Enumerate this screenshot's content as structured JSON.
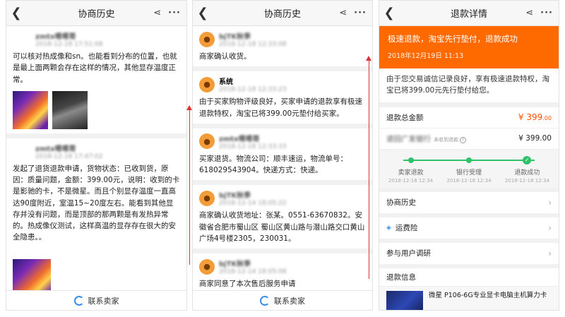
{
  "panel1": {
    "title": "协商历史",
    "posts": [
      {
        "name": "zmtx嗯嗯哥",
        "time": "2018-12-18 17:51:08",
        "text": "可以核对热成像和sn。也能看到分布的位置，也就是最上面两颗会存在这样的情况，其他显存温度正常。"
      },
      {
        "name": "zmtx嗯嗯哥",
        "time": "2018-12-18 17:47:02",
        "text": "发起了退货退款申请，货物状态：已收到货，原因：质量问题，金额：399.00元，说明：收到的卡是影驰的卡，不是微星。而且个别显存温度一直高达90度附近，室温15~20度左右。能看到其他显存并没有问题，而是顶部的那两颗是有发热异常的。热成像仪测试，这样高温的显存存在很大的安全隐患。。"
      }
    ],
    "contact": "联系卖家"
  },
  "panel2": {
    "title": "协商历史",
    "posts": [
      {
        "name": "bjTK秋季",
        "time": "2018-12-18 12:33:08",
        "text": "商家确认收货。"
      },
      {
        "name": "系统",
        "time": "2018-12-18 12:33:23",
        "text": "由于买家购物评级良好，买家申请的退款享有极速退款特权，淘宝已将399.00元垫付给买家。"
      },
      {
        "name": "zmtx嗯嗯哥",
        "time": "2018-12-18 12:33:33",
        "text": "买家退货。物流公司：顺丰速运，物流单号：618029543904。快递方式：快递。"
      },
      {
        "name": "bjTK秋季",
        "time": "2018-12-14 18:05:22",
        "text": "商家确认收货地址：张某。0551-63670832。安徽省合肥市蜀山区 蜀山区黄山路与潜山路交口黄山广场4号楼2305，230031。"
      },
      {
        "name": "bjTK秋季",
        "time": "2018-12-14 18:05:08",
        "text": "商家同意了本次售后服务申请"
      }
    ],
    "contact": "联系卖家"
  },
  "panel3": {
    "title": "退款详情",
    "status": "极速退款，淘宝先行垫付，退款成功",
    "status_time": "2018年12月19日 11:13",
    "desc": "由于您交易诚信记录良好，享有极速退款特权，淘宝已将399.00元先行垫付给您。",
    "total_label": "退款总金额",
    "total_value": "¥ 399",
    "total_decimals": ".00",
    "return_label": "退回广发银行",
    "return_note": "未收到退款",
    "return_value": "¥ 399.00",
    "steps": [
      {
        "label": "卖家退款",
        "time": "2018-12-18 12:34"
      },
      {
        "label": "银行受理",
        "time": "2018-12-18 12:34"
      },
      {
        "label": "退款成功",
        "time": "2018-12-18 12:34"
      }
    ],
    "history_label": "协商历史",
    "insurance_label": "运费险",
    "survey_label": "参与用户调研",
    "info_label": "退款信息",
    "product_name": "微星 P106-6G专业显卡电脑主机算力卡"
  },
  "colors": {
    "accent": "#ff6a00",
    "success": "#2fc26b",
    "annotation": "#dd3333"
  }
}
